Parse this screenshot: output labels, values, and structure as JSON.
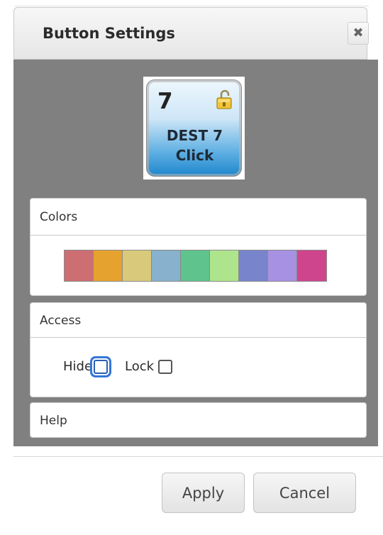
{
  "dialog": {
    "title": "Button Settings",
    "close_icon": "close-icon",
    "close_glyph": "✖"
  },
  "preview": {
    "number": "7",
    "line1": "DEST 7",
    "line2": "Click",
    "lock_icon": "unlocked-padlock-icon"
  },
  "colors": {
    "label": "Colors",
    "swatches": [
      "#cd6e72",
      "#e6a22e",
      "#d9c97b",
      "#87b1cc",
      "#5fc38e",
      "#aee58c",
      "#7885cc",
      "#a791e3",
      "#cf458d"
    ]
  },
  "access": {
    "label": "Access",
    "hide_label": "Hide",
    "hide_checked": false,
    "lock_label": "Lock",
    "lock_checked": false
  },
  "help": {
    "label": "Help"
  },
  "footer": {
    "apply_label": "Apply",
    "cancel_label": "Cancel"
  }
}
